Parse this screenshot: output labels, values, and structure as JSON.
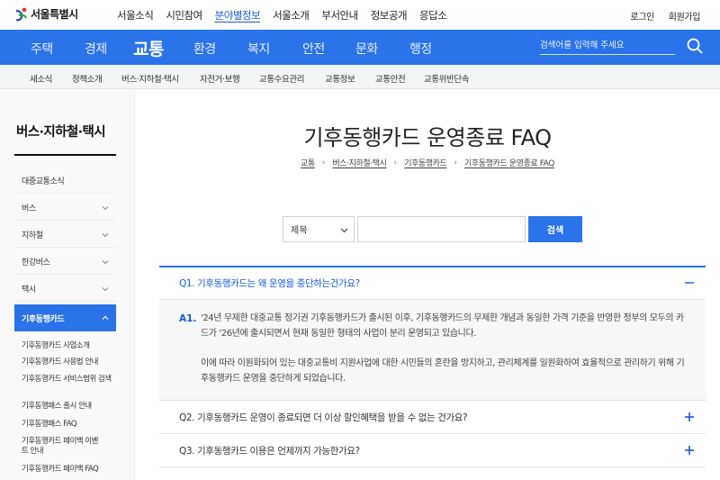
{
  "brand": {
    "name": "서울특별시",
    "accent": "#2a73e8"
  },
  "topnav": [
    "서울소식",
    "시민참여",
    "분야별정보",
    "서울소개",
    "부서안내",
    "정보공개",
    "응답소"
  ],
  "topnav_active": "분야별정보",
  "toplinks": {
    "login": "로그인",
    "signup": "회원가입"
  },
  "mainnav": {
    "items": [
      "주택",
      "경제",
      "교통",
      "환경",
      "복지",
      "안전",
      "문화",
      "행정"
    ],
    "active": "교통",
    "search_placeholder": "검색어를 입력해 주세요",
    "search_icon": "search-icon"
  },
  "subnav": [
    "새소식",
    "정책소개",
    "버스·지하철·택시",
    "자전거·보행",
    "교통수요관리",
    "교통정보",
    "교통안전",
    "교통위반단속"
  ],
  "sidebar": {
    "title": "버스·지하철·택시",
    "items": [
      "대중교통소식",
      "버스",
      "지하철",
      "한강버스",
      "택시",
      "기후동행카드"
    ],
    "active": "기후동행카드",
    "sub_items": [
      "기후동행카드 사업소개",
      "기후동행카드 사용법 안내",
      "기후동행카드 서비스범위 검색",
      "기후동행패스 출시 안내",
      "기후동행패스 FAQ",
      "기후동행카드 페이백 이벤트 안내",
      "기후동행카드 페이백 FAQ"
    ]
  },
  "page": {
    "title": "기후동행카드 운영종료 FAQ",
    "breadcrumb": [
      "교통",
      "버스·지하철·택시",
      "기후동행카드",
      "기후동행카드 운영종료 FAQ"
    ]
  },
  "filter": {
    "select_value": "제목",
    "input_value": "",
    "button_label": "검색"
  },
  "faq": [
    {
      "q_label": "Q1.",
      "question": "기후동행카드는 왜 운영을 중단하는건가요?",
      "open": true,
      "a_label": "A1.",
      "answer": [
        "'24년 무제한 대중교통 정기권 기후동행카드가 출시된 이후, 기후동행카드의 무제한 개념과 동일한 가격 기준을 반영한 정부의 모두의 카드가 '26년에 출시되면서 현재 동일한 형태의 사업이 분리 운영되고 있습니다.",
        "이에 따라 이원화되어 있는 대중교통비 지원사업에 대한 시민들의 혼란을 방지하고, 관리체계를 일원화하여 효율적으로 관리하기 위해 기후동행카드 운영을 중단하게 되었습니다."
      ]
    },
    {
      "q_label": "Q2.",
      "question": "기후동행카드 운영이 종료되면 더 이상 할인혜택을 받을 수 없는 건가요?",
      "open": false
    },
    {
      "q_label": "Q3.",
      "question": "기후동행카드 이용은 언제까지 가능한가요?",
      "open": false
    }
  ]
}
